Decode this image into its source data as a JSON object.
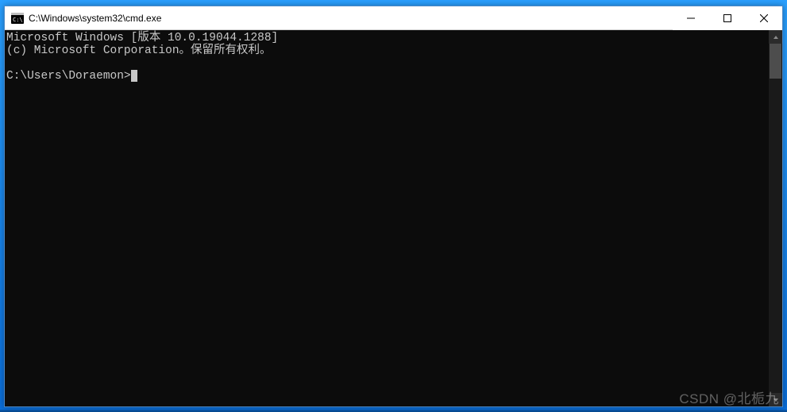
{
  "window": {
    "title": "C:\\Windows\\system32\\cmd.exe"
  },
  "terminal": {
    "line1": "Microsoft Windows [版本 10.0.19044.1288]",
    "line2": "(c) Microsoft Corporation。保留所有权利。",
    "blank": "",
    "prompt": "C:\\Users\\Doraemon>"
  },
  "watermark": "CSDN @北栀九"
}
